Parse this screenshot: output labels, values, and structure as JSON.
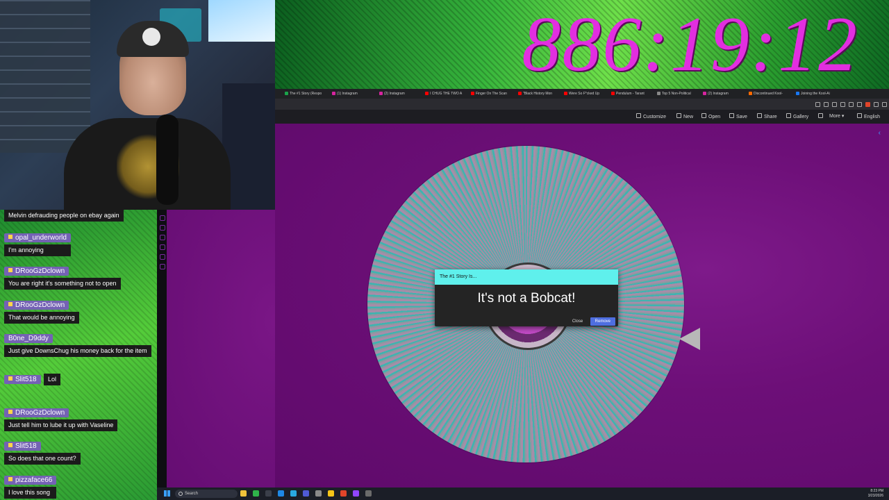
{
  "stream": {
    "timer": "886:19:12"
  },
  "chat": {
    "messages": [
      {
        "user": "",
        "text": "Melvin defrauding people on ebay again"
      },
      {
        "user": "opal_underworld",
        "text": "I'm annoying"
      },
      {
        "user": "DRooGzDclown",
        "text": "You are right it's something not to open"
      },
      {
        "user": "DRooGzDclown",
        "text": "That would be annoying"
      },
      {
        "user": "B0ne_D9ddy",
        "text": "Just give DownsChug his money back for the item"
      },
      {
        "user": "Slit518",
        "text": "Lol"
      },
      {
        "user": "DRooGzDclown",
        "text": "Just tell him to lube it up with Vaseline"
      },
      {
        "user": "Slit518",
        "text": "So does that one count?"
      },
      {
        "user": "pizzaface66",
        "text": "I love this song"
      }
    ]
  },
  "browser": {
    "tabs": [
      "The #1 Story (Respo",
      "(1) Instagram",
      "(2) Instagram",
      "I CHUG THE TWO A",
      "Finger On The Scan",
      "\"Black History Mon",
      "Were So F*cked Up",
      "Pendulum - Tarant",
      "Top 5 Non-Political",
      "(2) Instagram",
      "Discontinued Kool-",
      "Joining the Kool-Ai"
    ],
    "toolbar": {
      "customize": "Customize",
      "new": "New",
      "open": "Open",
      "save": "Save",
      "share": "Share",
      "gallery": "Gallery",
      "more": "More",
      "language": "English"
    }
  },
  "dialog": {
    "title": "The #1 Story Is...",
    "result": "It's not a Bobcat!",
    "close_label": "Close",
    "remove_label": "Remove"
  },
  "taskbar": {
    "search_placeholder": "Search",
    "time": "8:23 PM",
    "date": "3/23/2026"
  },
  "colors": {
    "timer": "#e22ee0",
    "dialog_header": "#5ff0ec",
    "remove_button": "#4e6ee0",
    "canvas_bg": "#6d0f78"
  }
}
